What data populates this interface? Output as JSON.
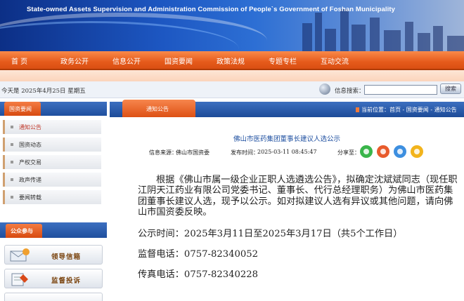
{
  "header": {
    "title": "State-owned Assets Supervision and Administration Commission of  People`s Government of Foshan Municipality"
  },
  "nav": {
    "items": [
      "首  页",
      "政务公开",
      "信息公开",
      "国资要闻",
      "政策法规",
      "专题专栏",
      "互动交流"
    ]
  },
  "toolbar": {
    "date": "今天是 2025年4月25日  星期五",
    "search_label": "信息搜索：",
    "search_value": "",
    "search_button": "搜索"
  },
  "sidebar": {
    "section_title": "国资要闻",
    "items": [
      "通知公告",
      "国资动态",
      "产权交易",
      "政声传递",
      "要闻转载"
    ],
    "section2_title": "公众参与",
    "buttons": [
      "领导信箱",
      "监督投诉"
    ]
  },
  "main": {
    "tab": "通知公告",
    "breadcrumb": "当前位置：首页 - 国资要闻 - 通知公告",
    "article_title": "佛山市医药集团董事长建议人选公示",
    "source_label": "信息来源：",
    "source_value": "佛山市国资委",
    "date_label": "发布时间：",
    "date_value": "2025-03-11 08:45:47",
    "share_label": "分享至：",
    "body": "根据《佛山市属一级企业正职人选遴选公告》，拟确定沈斌斌同志（现任职江阴天江药业有限公司党委书记、董事长、代行总经理职务）为佛山市医药集团董事长建议人选，现予以公示。如对拟建议人选有异议或其他问题，请向佛山市国资委反映。",
    "publicity_time": "公示时间：2025年3月11日至2025年3月17日（共5个工作日）",
    "supervision_phone": "监督电话：0757-82340052",
    "fax": "传真电话：0757-82340228"
  },
  "colors": {
    "nav": "#e65b1c",
    "bar": "#1f4f9e",
    "title": "#1e4fa0",
    "share_icons": [
      "#39b54a",
      "#e85b2c",
      "#3d8fe0",
      "#f2b41c"
    ]
  }
}
